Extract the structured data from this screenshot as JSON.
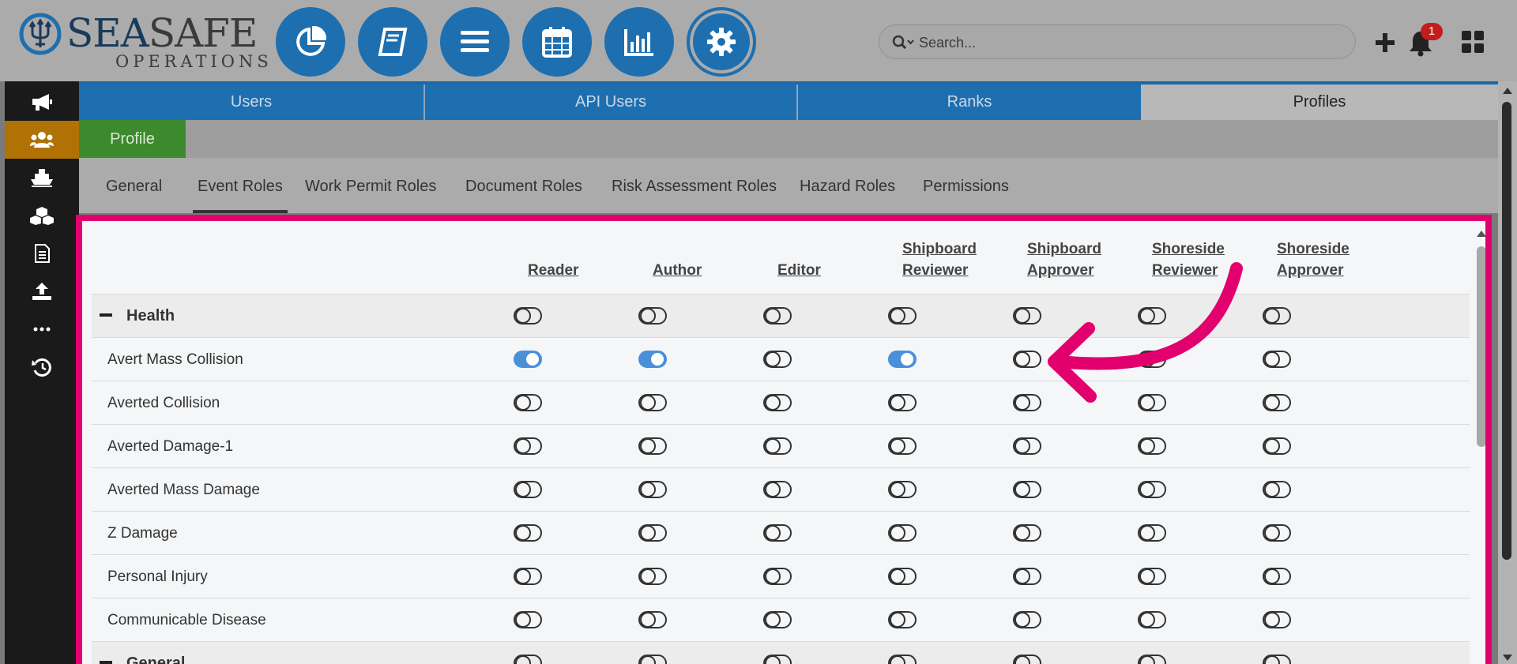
{
  "brand": {
    "name_part1": "SEA",
    "name_part2": "SAFE",
    "subtitle": "OPERATIONS"
  },
  "nav_buttons": [
    {
      "name": "dashboard-nav-button",
      "icon": "pie-chart-icon"
    },
    {
      "name": "logbook-nav-button",
      "icon": "book-icon"
    },
    {
      "name": "menu-nav-button",
      "icon": "list-icon"
    },
    {
      "name": "calendar-nav-button",
      "icon": "calendar-icon"
    },
    {
      "name": "reports-nav-button",
      "icon": "bar-chart-icon"
    },
    {
      "name": "settings-nav-button",
      "icon": "gear-icon",
      "active": true
    }
  ],
  "search": {
    "placeholder": "Search..."
  },
  "notifications": {
    "count": "1"
  },
  "sidebar": [
    {
      "icon": "megaphone-icon"
    },
    {
      "icon": "users-icon",
      "active": true
    },
    {
      "icon": "ship-icon"
    },
    {
      "icon": "cubes-icon"
    },
    {
      "icon": "document-icon"
    },
    {
      "icon": "upload-icon"
    },
    {
      "icon": "more-icon"
    },
    {
      "icon": "history-icon"
    }
  ],
  "tabs": [
    {
      "label": "Users"
    },
    {
      "label": "API Users"
    },
    {
      "label": "Ranks"
    },
    {
      "label": "Profiles",
      "active": true
    }
  ],
  "profile_tab": "Profile",
  "subtabs": [
    {
      "label": "General"
    },
    {
      "label": "Event Roles",
      "active": true
    },
    {
      "label": "Work Permit Roles"
    },
    {
      "label": "Document Roles"
    },
    {
      "label": "Risk Assessment Roles"
    },
    {
      "label": "Hazard Roles"
    },
    {
      "label": "Permissions"
    }
  ],
  "columns": [
    {
      "line1": "",
      "line2": "Reader"
    },
    {
      "line1": "",
      "line2": "Author"
    },
    {
      "line1": "",
      "line2": "Editor"
    },
    {
      "line1": "Shipboard",
      "line2": "Reviewer"
    },
    {
      "line1": "Shipboard",
      "line2": "Approver"
    },
    {
      "line1": "Shoreside",
      "line2": "Reviewer"
    },
    {
      "line1": "Shoreside",
      "line2": "Approver"
    }
  ],
  "rows": [
    {
      "label": "Health",
      "group": true,
      "values": [
        false,
        false,
        false,
        false,
        false,
        false,
        false
      ]
    },
    {
      "label": "Avert Mass Collision",
      "values": [
        true,
        true,
        false,
        true,
        false,
        false,
        false
      ]
    },
    {
      "label": "Averted Collision",
      "values": [
        false,
        false,
        false,
        false,
        false,
        false,
        false
      ]
    },
    {
      "label": "Averted Damage-1",
      "values": [
        false,
        false,
        false,
        false,
        false,
        false,
        false
      ]
    },
    {
      "label": "Averted Mass Damage",
      "values": [
        false,
        false,
        false,
        false,
        false,
        false,
        false
      ]
    },
    {
      "label": "Z Damage",
      "values": [
        false,
        false,
        false,
        false,
        false,
        false,
        false
      ]
    },
    {
      "label": "Personal Injury",
      "values": [
        false,
        false,
        false,
        false,
        false,
        false,
        false
      ]
    },
    {
      "label": "Communicable Disease",
      "values": [
        false,
        false,
        false,
        false,
        false,
        false,
        false
      ]
    },
    {
      "label": "General",
      "group": true,
      "values": [
        false,
        false,
        false,
        false,
        false,
        false,
        false
      ]
    }
  ],
  "colors": {
    "accent": "#1d6fb0",
    "highlight": "#e2006e",
    "toggle_on": "#4a90d9",
    "profile_green": "#3d8a2e",
    "sidebar_active": "#b07205"
  }
}
